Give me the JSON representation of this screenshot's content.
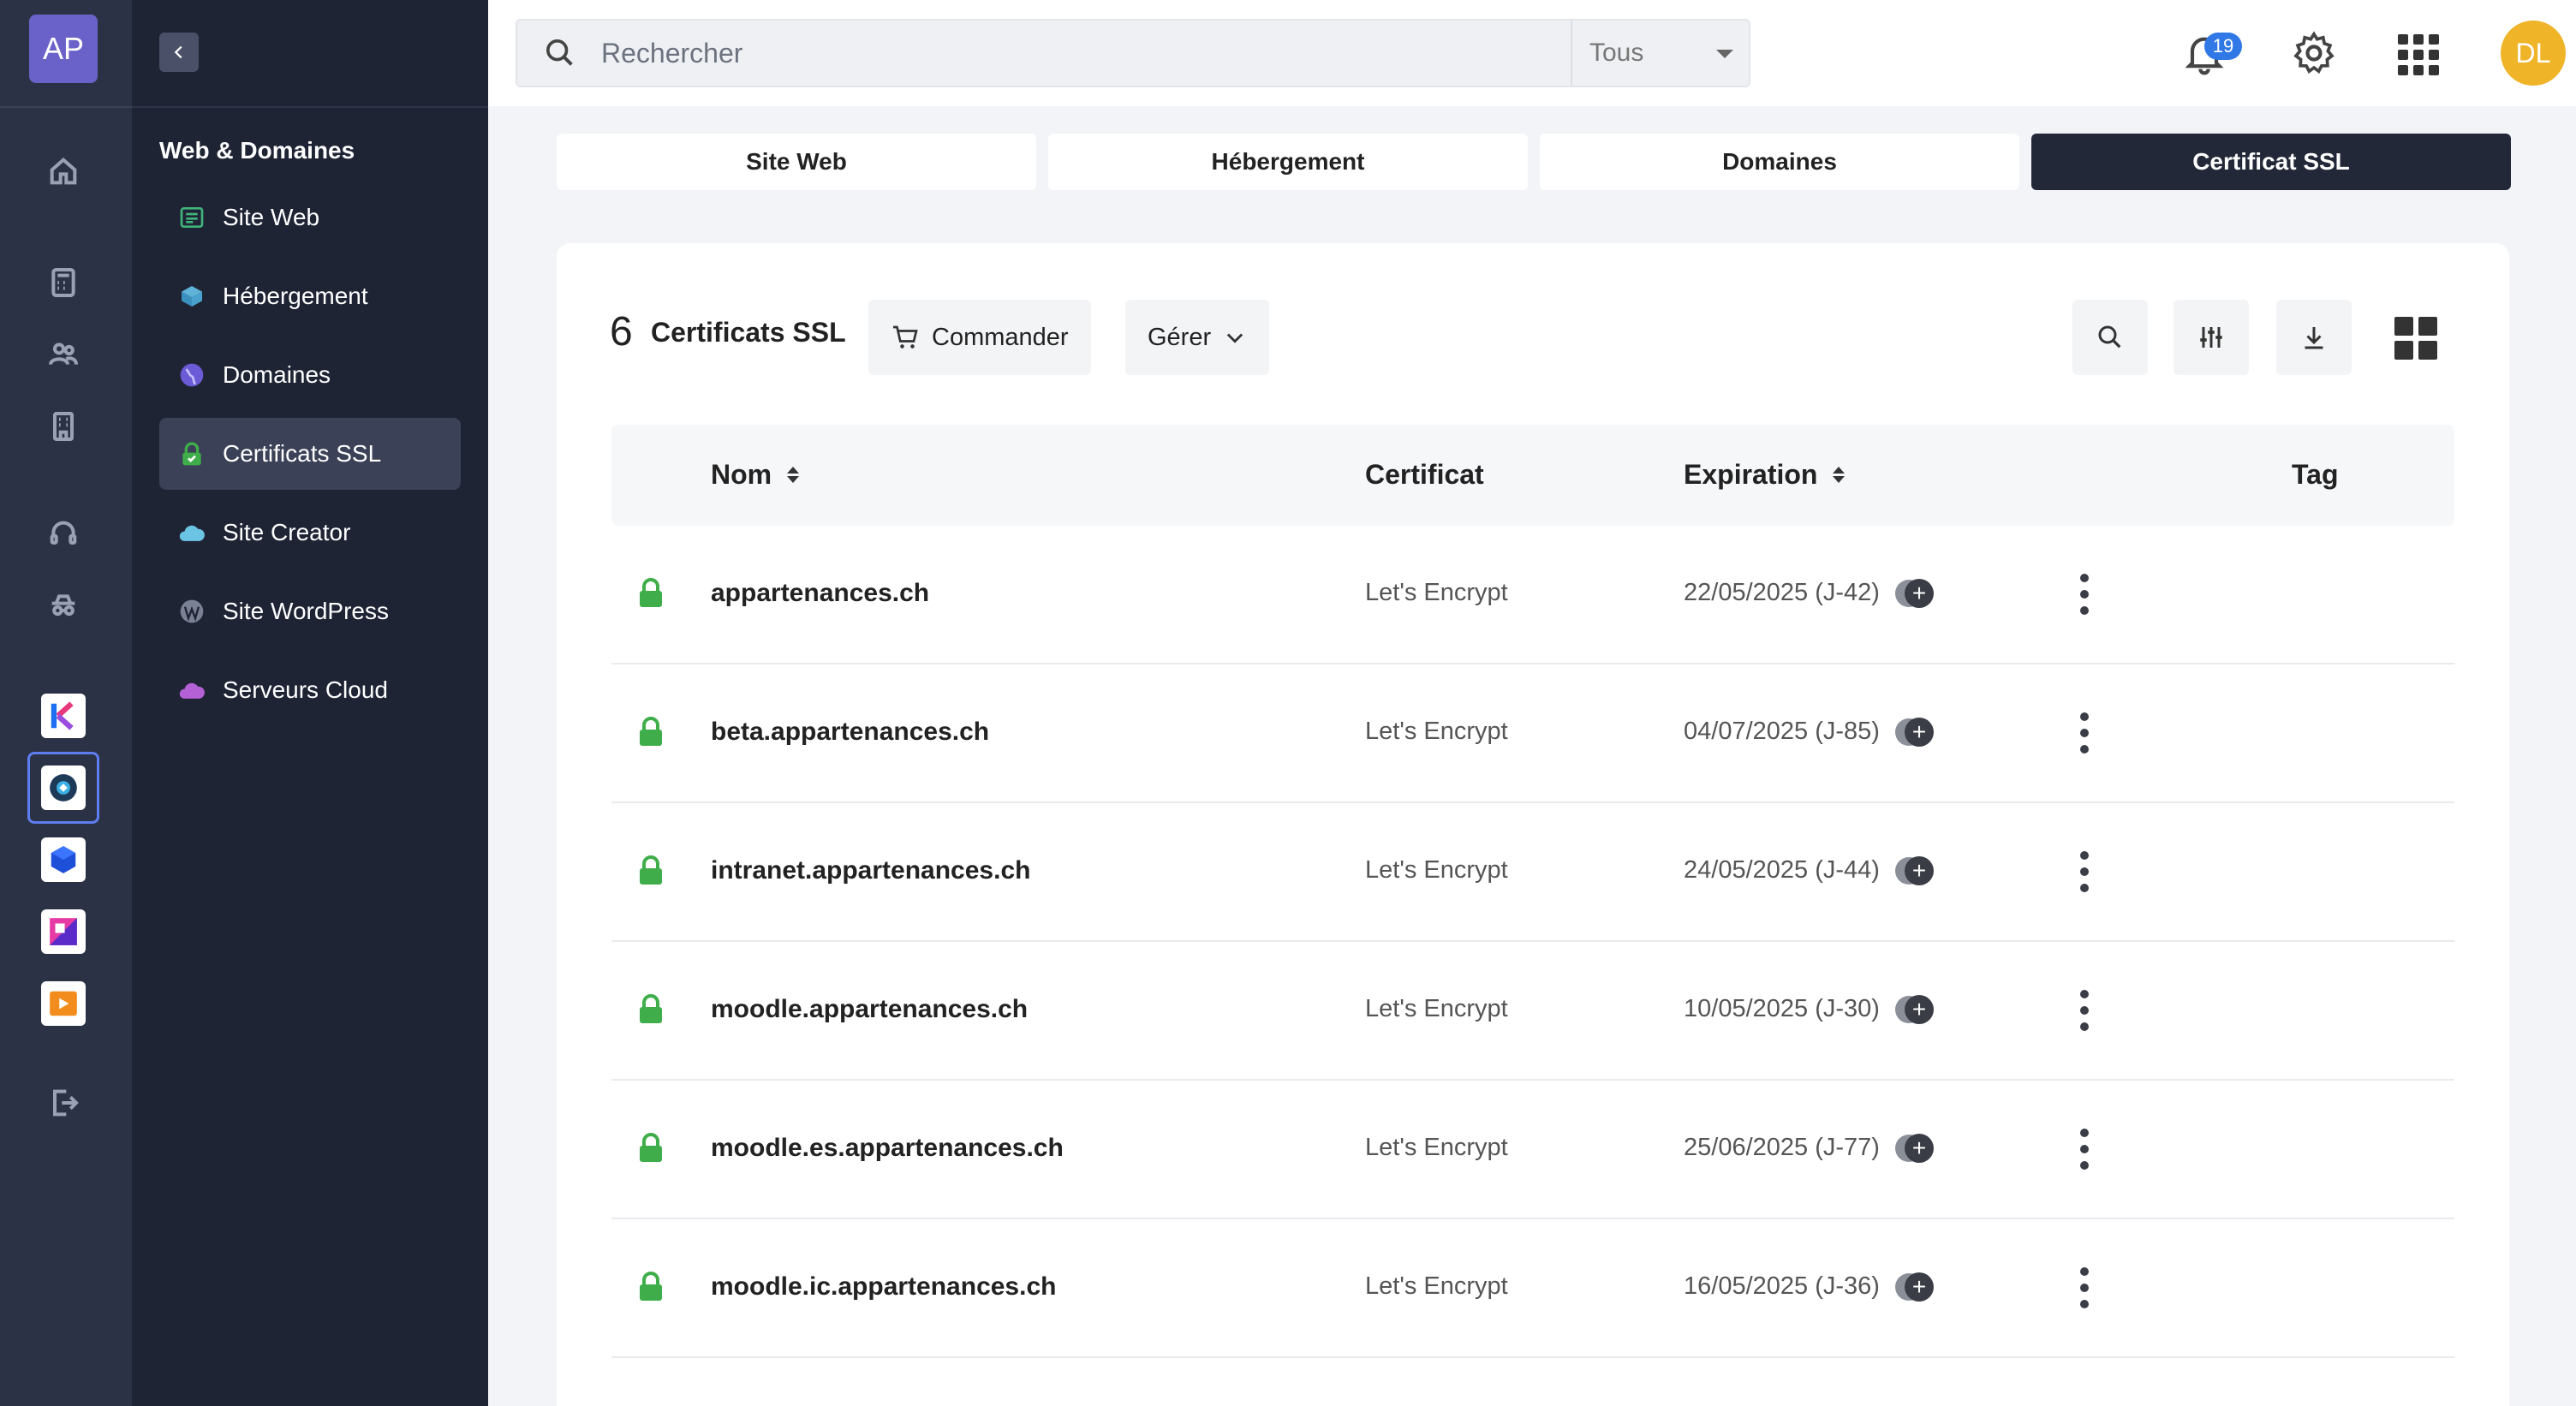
{
  "account": {
    "initials": "AP"
  },
  "user": {
    "initials": "DL"
  },
  "notifications": {
    "count": "19"
  },
  "search": {
    "placeholder": "Rechercher",
    "scope": "Tous"
  },
  "sidebar": {
    "heading": "Web & Domaines",
    "items": [
      {
        "label": "Site Web",
        "icon": "website-icon"
      },
      {
        "label": "Hébergement",
        "icon": "hosting-icon"
      },
      {
        "label": "Domaines",
        "icon": "globe-icon"
      },
      {
        "label": "Certificats SSL",
        "icon": "ssl-lock-icon",
        "active": true
      },
      {
        "label": "Site Creator",
        "icon": "cloud-icon"
      },
      {
        "label": "Site WordPress",
        "icon": "wordpress-icon"
      },
      {
        "label": "Serveurs Cloud",
        "icon": "cloud-server-icon"
      }
    ]
  },
  "tabs": [
    {
      "label": "Site Web"
    },
    {
      "label": "Hébergement"
    },
    {
      "label": "Domaines"
    },
    {
      "label": "Certificat SSL",
      "active": true
    }
  ],
  "toolbar": {
    "count": "6",
    "count_label": "Certificats SSL",
    "order_label": "Commander",
    "manage_label": "Gérer"
  },
  "table": {
    "columns": {
      "name": "Nom",
      "certificate": "Certificat",
      "expiration": "Expiration",
      "tag": "Tag"
    },
    "rows": [
      {
        "name": "appartenances.ch",
        "certificate": "Let's Encrypt",
        "expiration": "22/05/2025 (J-42)"
      },
      {
        "name": "beta.appartenances.ch",
        "certificate": "Let's Encrypt",
        "expiration": "04/07/2025 (J-85)"
      },
      {
        "name": "intranet.appartenances.ch",
        "certificate": "Let's Encrypt",
        "expiration": "24/05/2025 (J-44)"
      },
      {
        "name": "moodle.appartenances.ch",
        "certificate": "Let's Encrypt",
        "expiration": "10/05/2025 (J-30)"
      },
      {
        "name": "moodle.es.appartenances.ch",
        "certificate": "Let's Encrypt",
        "expiration": "25/06/2025 (J-77)"
      },
      {
        "name": "moodle.ic.appartenances.ch",
        "certificate": "Let's Encrypt",
        "expiration": "16/05/2025 (J-36)"
      }
    ]
  },
  "colors": {
    "accent": "#6a62c9",
    "lock_green": "#3fae4a",
    "badge_blue": "#2f78e6",
    "avatar_yellow": "#f0b429"
  }
}
